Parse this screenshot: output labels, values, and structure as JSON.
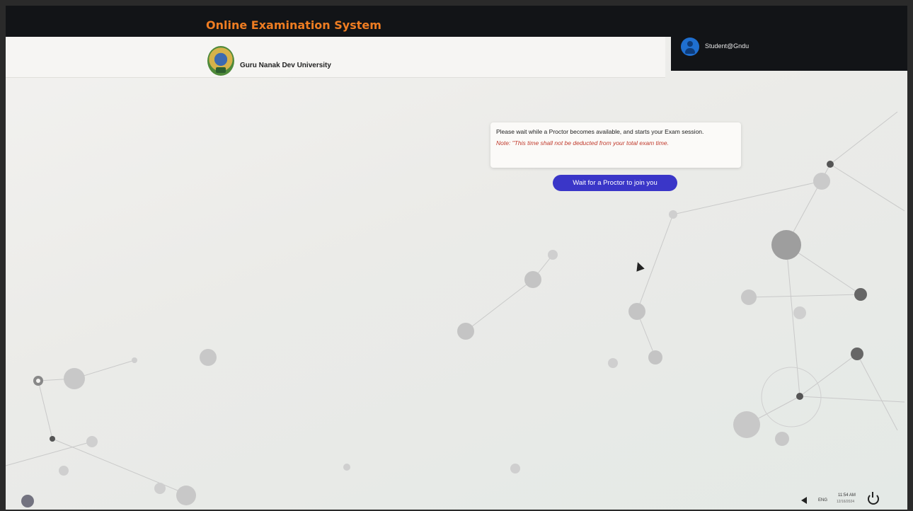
{
  "app": {
    "title": "Online Examination System",
    "university": "Guru Nanak Dev University",
    "user": "Student@Gndu",
    "accent_color": "#ef7d22",
    "bar_color": "#121417"
  },
  "notice": {
    "message": "Please wait while a Proctor becomes available, and starts your Exam session.",
    "note": "Note: \"This time shall not be deducted from your total exam time."
  },
  "actions": {
    "wait_label": "Wait for a Proctor to join you",
    "button_color": "#3a36c8"
  },
  "taskbar": {
    "language": "ENG",
    "time": "11:54 AM",
    "date": "12/16/2024"
  },
  "icons": [
    "user-avatar-icon",
    "university-logo",
    "volume-icon",
    "power-icon",
    "start-icon"
  ]
}
